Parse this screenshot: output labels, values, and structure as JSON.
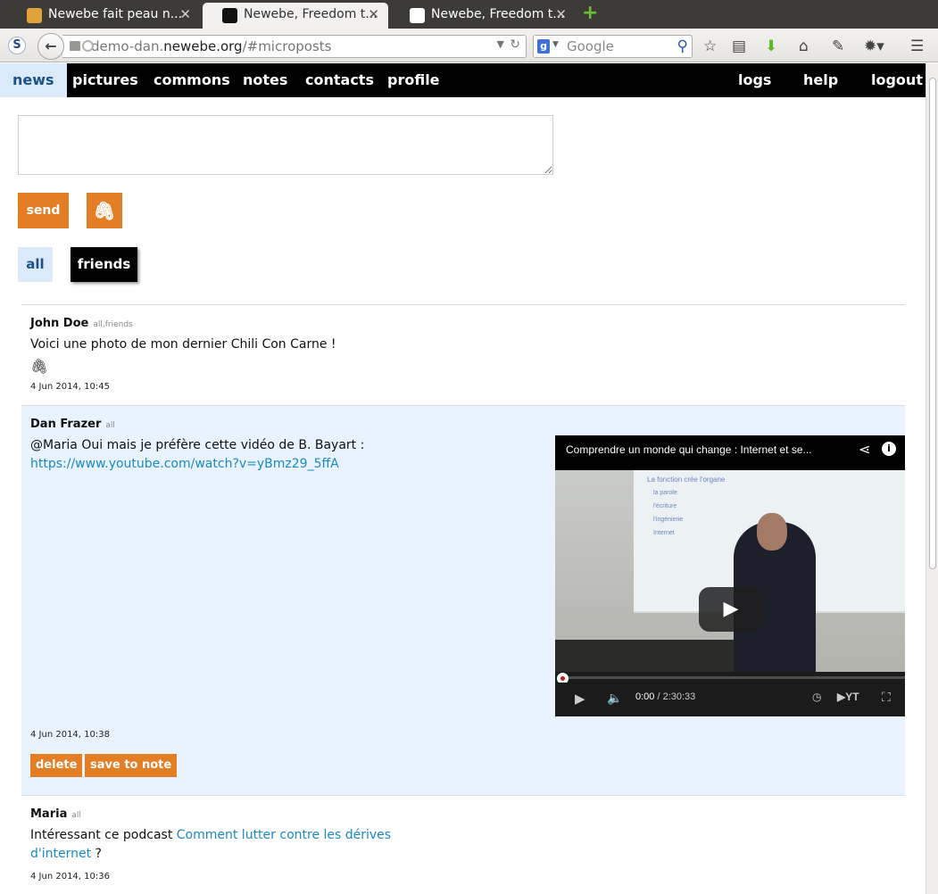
{
  "browser": {
    "tabs": [
      {
        "title": "Newebe fait peau n..."
      },
      {
        "title": "Newebe, Freedom t..."
      },
      {
        "title": "Newebe, Freedom t..."
      }
    ],
    "url_prefix": "demo-dan.",
    "url_host": "newebe.org",
    "url_path": "/#microposts",
    "search_placeholder": "Google"
  },
  "menu": {
    "left": [
      "news",
      "pictures",
      "commons",
      "notes",
      "contacts",
      "profile"
    ],
    "right": [
      "logs",
      "help",
      "logout"
    ]
  },
  "composer": {
    "send_label": "send",
    "filters": [
      "all",
      "friends"
    ]
  },
  "posts": [
    {
      "author": "John Doe",
      "tags": "all,friends",
      "text": "Voici une photo de mon dernier Chili Con Carne !",
      "date": "4 Jun 2014, 10:45"
    },
    {
      "author": "Dan Frazer",
      "tags": "all",
      "text": "@Maria Oui mais je préfère cette vidéo de B. Bayart :",
      "link": "https://www.youtube.com/watch?v=yBmz29_5ffA",
      "date": "4 Jun 2014, 10:38",
      "actions": [
        "delete",
        "save to note"
      ],
      "video": {
        "title": "Comprendre un monde qui change : Internet et se...",
        "time_current": "0:00",
        "time_total": "2:30:33",
        "slide_title": "La fonction crée l'organe",
        "slide_bullets": [
          "la parole",
          "l'écriture",
          "l'ingénierie",
          "Internet"
        ]
      }
    },
    {
      "author": "Maria",
      "tags": "all",
      "text_before": "Intéressant ce podcast",
      "link_text_1": "Comment lutter contre les dérives",
      "link_text_2": "d'internet",
      "text_after": "?",
      "date": "4 Jun 2014, 10:36"
    }
  ],
  "colors": {
    "accent": "#e47e24",
    "link": "#1a89c7",
    "active_tab_bg": "#dbeaf9",
    "post_highlight": "#e8f3fd"
  }
}
